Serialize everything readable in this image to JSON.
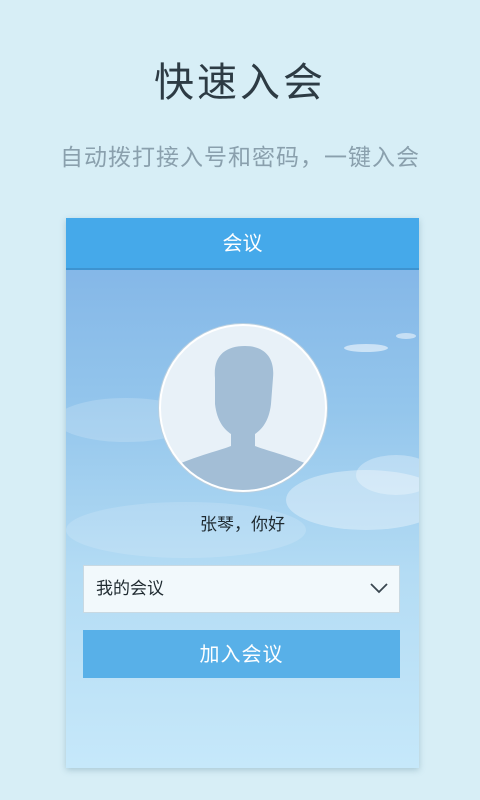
{
  "promo": {
    "headline": "快速入会",
    "subline": "自动拨打接入号和密码，一键入会"
  },
  "app": {
    "title": "会议",
    "greeting": "张琴，你好",
    "meeting_select": {
      "value": "我的会议",
      "icon": "chevron-down-icon"
    },
    "join_button": "加入会议",
    "avatar_icon": "user-silhouette-icon"
  },
  "colors": {
    "page_bg": "#d7eef6",
    "titlebar": "#45a9ea",
    "button": "#58b0e8"
  }
}
